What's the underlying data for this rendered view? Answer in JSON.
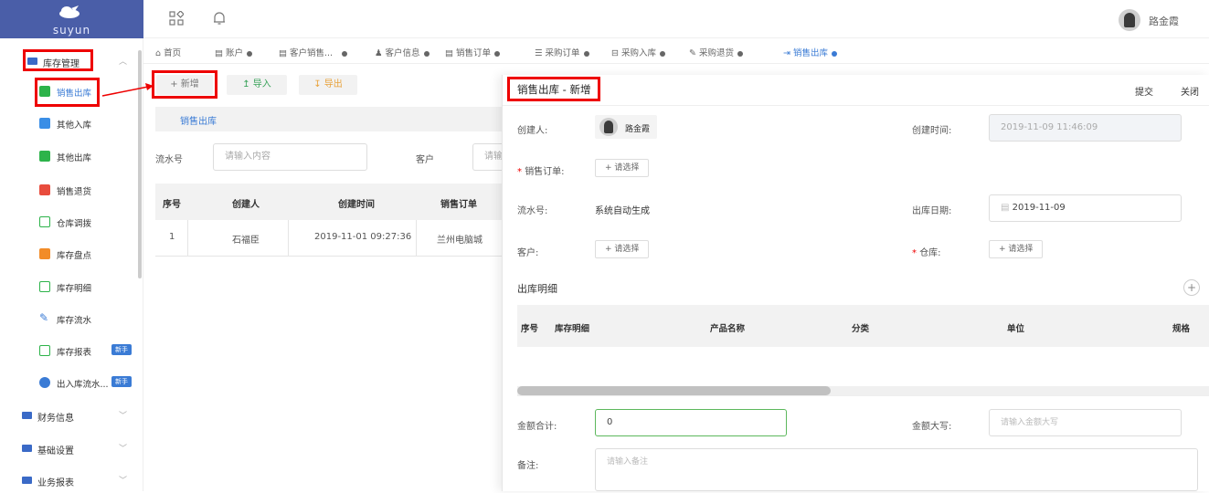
{
  "app": {
    "brand": "suyun",
    "user_name": "路金霞"
  },
  "sidebar": {
    "group_inventory": "库存管理",
    "items": [
      {
        "label": "销售出库",
        "color": "#2db34a"
      },
      {
        "label": "其他入库",
        "color": "#3a8ee6"
      },
      {
        "label": "其他出库",
        "color": "#2db34a"
      },
      {
        "label": "销售退货",
        "color": "#e84c3d"
      },
      {
        "label": "仓库调拨",
        "color": "#2db34a"
      },
      {
        "label": "库存盘点",
        "color": "#f28c28"
      },
      {
        "label": "库存明细",
        "color": "#2db34a"
      },
      {
        "label": "库存流水",
        "color": "#3a7bd5"
      },
      {
        "label": "库存报表",
        "color": "#2db34a",
        "badge": "新手"
      },
      {
        "label": "出入库流水...",
        "color": "#3a7bd5",
        "badge": "新手"
      }
    ],
    "groups": [
      "财务信息",
      "基础设置",
      "业务报表"
    ]
  },
  "tabs": [
    "首页",
    "账户",
    "客户销售...",
    "客户信息",
    "销售订单",
    "采购订单",
    "采购入库",
    "采购退货",
    "销售出库"
  ],
  "toolbar": {
    "add": "+ 新增",
    "import": "↥ 导入",
    "export": "↧ 导出"
  },
  "list": {
    "section_title": "销售出库",
    "filter_serial_label": "流水号",
    "filter_serial_placeholder": "请输入内容",
    "filter_customer_label": "客户",
    "filter_customer_placeholder": "请输",
    "columns": [
      "序号",
      "创建人",
      "创建时间",
      "销售订单"
    ],
    "rows": [
      {
        "no": "1",
        "creator": "石福臣",
        "time": "2019-11-01 09:27:36",
        "order": "兰州电脑城"
      }
    ]
  },
  "drawer": {
    "title": "销售出库 - 新增",
    "submit": "提交",
    "close": "关闭",
    "creator_label": "创建人:",
    "creator_value": "路金霞",
    "created_time_label": "创建时间:",
    "created_time_value": "2019-11-09 11:46:09",
    "sales_order_label": "销售订单:",
    "choose": "+ 请选择",
    "serial_label": "流水号:",
    "serial_value": "系统自动生成",
    "out_date_label": "出库日期:",
    "out_date_value": "2019-11-09",
    "customer_label": "客户:",
    "warehouse_label": "仓库:",
    "detail_title": "出库明细",
    "detail_columns": [
      "序号",
      "库存明细",
      "产品名称",
      "分类",
      "单位",
      "规格"
    ],
    "total_label": "金额合计:",
    "total_value": "0",
    "uppercase_label": "金额大写:",
    "uppercase_placeholder": "请输入金额大写",
    "remark_label": "备注:",
    "remark_placeholder": "请输入备注"
  }
}
